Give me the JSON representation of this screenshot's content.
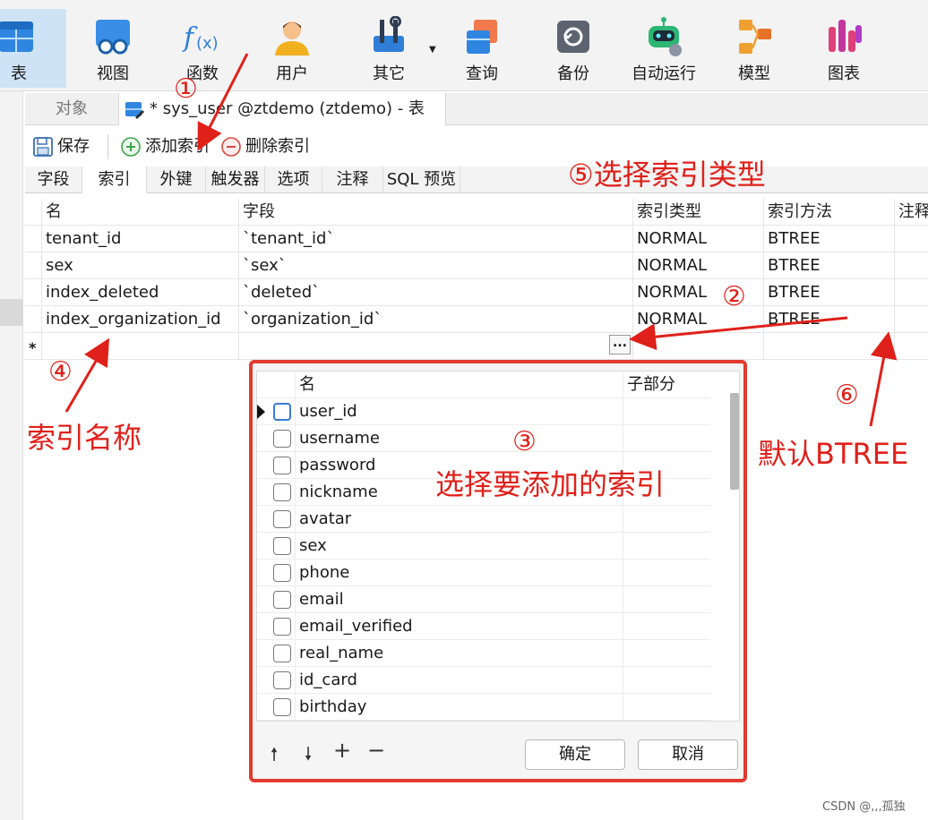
{
  "ribbon": {
    "buttons": [
      {
        "label": "表",
        "icon": "table-icon",
        "active": true
      },
      {
        "label": "视图",
        "icon": "view-icon"
      },
      {
        "label": "函数",
        "icon": "function-icon"
      },
      {
        "label": "用户",
        "icon": "user-icon"
      },
      {
        "label": "其它",
        "icon": "tools-icon",
        "has_dropdown": true
      },
      {
        "label": "查询",
        "icon": "query-icon"
      },
      {
        "label": "备份",
        "icon": "backup-icon"
      },
      {
        "label": "自动运行",
        "icon": "robot-icon"
      },
      {
        "label": "模型",
        "icon": "model-icon"
      },
      {
        "label": "图表",
        "icon": "chart-icon"
      }
    ]
  },
  "doc_tabs": {
    "objects_label": "对象",
    "current_title": "* sys_user @ztdemo (ztdemo) - 表"
  },
  "toolbar": {
    "save_label": "保存",
    "add_index_label": "添加索引",
    "delete_index_label": "删除索引"
  },
  "sub_tabs": [
    "字段",
    "索引",
    "外键",
    "触发器",
    "选项",
    "注释",
    "SQL 预览"
  ],
  "sub_tabs_active": "索引",
  "index_table": {
    "columns": [
      "名",
      "字段",
      "索引类型",
      "索引方法",
      "注释"
    ],
    "rows": [
      {
        "name": "tenant_id",
        "field": "`tenant_id`",
        "type": "NORMAL",
        "method": "BTREE"
      },
      {
        "name": "sex",
        "field": "`sex`",
        "type": "NORMAL",
        "method": "BTREE"
      },
      {
        "name": "index_deleted",
        "field": "`deleted`",
        "type": "NORMAL",
        "method": "BTREE"
      },
      {
        "name": "index_organization_id",
        "field": "`organization_id`",
        "type": "NORMAL",
        "method": "BTREE"
      }
    ],
    "new_row_marker": "*",
    "ellipsis_label": "..."
  },
  "field_picker": {
    "columns": [
      "名",
      "子部分"
    ],
    "fields": [
      "user_id",
      "username",
      "password",
      "nickname",
      "avatar",
      "sex",
      "phone",
      "email",
      "email_verified",
      "real_name",
      "id_card",
      "birthday"
    ],
    "ok_label": "确定",
    "cancel_label": "取消",
    "footer_icons": [
      "move-up-icon",
      "move-down-icon",
      "add-icon",
      "remove-icon"
    ]
  },
  "annotations": {
    "n1": "①",
    "n2": "②",
    "n3": "③",
    "n4": "④",
    "n5_text": "⑤选择索引类型",
    "n6": "⑥",
    "index_name": "索引名称",
    "choose_fields": "选择要添加的索引",
    "default_btree": "默认BTREE",
    "color": "#e0201a"
  },
  "watermark": "CSDN @,,,孤独"
}
